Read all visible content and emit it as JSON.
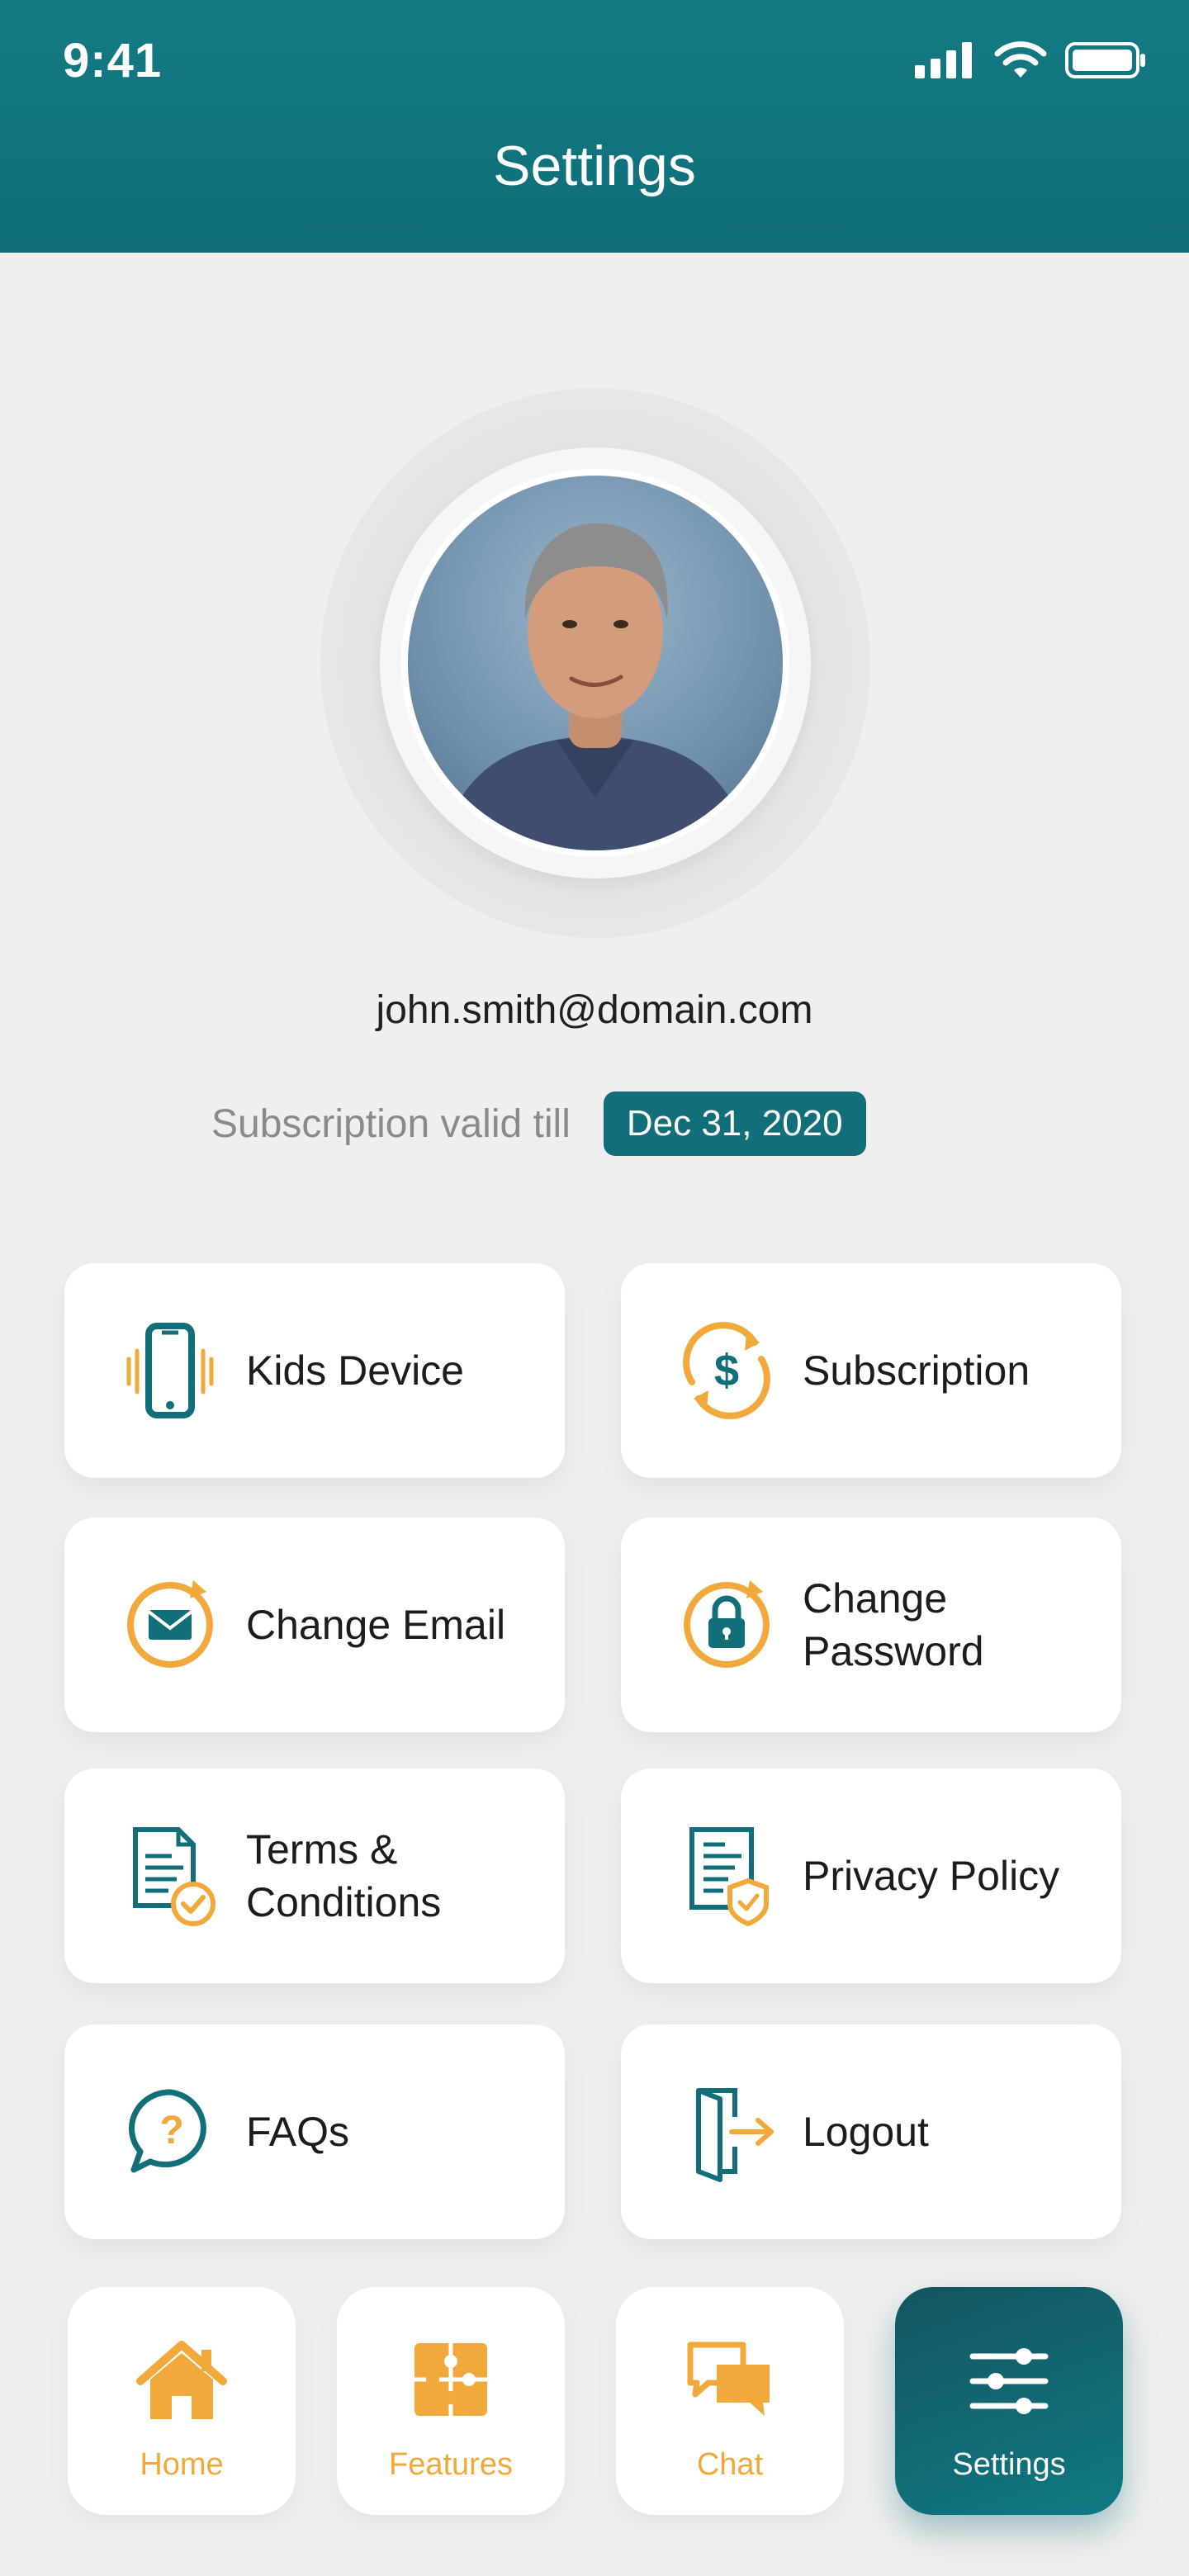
{
  "status_bar": {
    "time": "9:41"
  },
  "header": {
    "title": "Settings"
  },
  "profile": {
    "email": "john.smith@domain.com",
    "subscription_label": "Subscription valid till",
    "subscription_date": "Dec 31, 2020"
  },
  "menu": {
    "kids_device": "Kids Device",
    "subscription": "Subscription",
    "change_email": "Change Email",
    "change_password_1": "Change",
    "change_password_2": "Password",
    "terms_1": "Terms &",
    "terms_2": "Conditions",
    "privacy_policy": "Privacy Policy",
    "faqs": "FAQs",
    "logout": "Logout"
  },
  "nav": {
    "home": "Home",
    "features": "Features",
    "chat": "Chat",
    "settings": "Settings"
  },
  "colors": {
    "teal": "#126f79",
    "orange": "#f2a93b",
    "background": "#efefef"
  }
}
